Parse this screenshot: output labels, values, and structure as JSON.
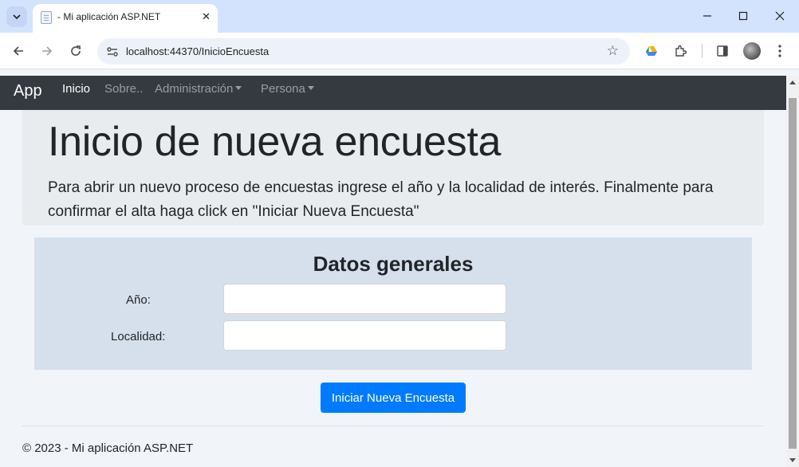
{
  "browser": {
    "tab": {
      "title": "- Mi aplicación ASP.NET",
      "close": "✕"
    },
    "window": {
      "minimize": "–",
      "maximize": "☐",
      "close": "✕"
    },
    "url": "localhost:44370/InicioEncuesta",
    "icons": [
      "tab-search-icon",
      "back-arrow-icon",
      "forward-arrow-icon",
      "reload-icon",
      "site-info-icon",
      "bookmark-star-icon",
      "google-drive-icon",
      "extensions-icon",
      "side-panel-icon",
      "profile-avatar-icon",
      "menu-kebab-icon"
    ]
  },
  "navbar": {
    "brand": "App",
    "links": [
      {
        "label": "Inicio",
        "active": true
      },
      {
        "label": "Sobre..",
        "active": false
      },
      {
        "label": "Administración",
        "dropdown": true
      },
      {
        "label": "Persona",
        "dropdown": true
      }
    ]
  },
  "jumbotron": {
    "title": "Inicio de nueva encuesta",
    "lead": "Para abrir un nuevo proceso de encuestas ingrese el año y la localidad de interés. Finalmente para confirmar el alta haga click en \"Iniciar Nueva Encuesta\""
  },
  "form": {
    "title": "Datos generales",
    "fields": [
      {
        "label": "Año:",
        "value": ""
      },
      {
        "label": "Localidad:",
        "value": ""
      }
    ],
    "submit_label": "Iniciar Nueva Encuesta"
  },
  "footer": {
    "text": "© 2023 - Mi aplicación ASP.NET"
  },
  "colors": {
    "navbar": "#343a40",
    "primary": "#007bff",
    "jumbotron": "#e9ecef",
    "form_card": "#d6e0ec",
    "tabstrip": "#d3e3fd"
  }
}
